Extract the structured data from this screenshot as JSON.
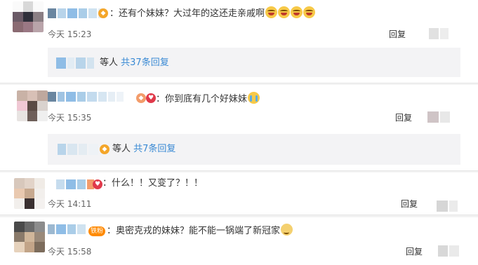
{
  "comments": [
    {
      "text": "：还有个妹妹？大过年的这还走亲戚啊",
      "time": "今天 15:23",
      "reply_label": "回复",
      "emoji_icons": [
        "laughing-tears-icon",
        "laughing-tears-icon",
        "laughing-tears-icon",
        "laughing-tears-icon"
      ],
      "sub_thread": {
        "people_suffix": "等人",
        "count_link": "共37条回复"
      }
    },
    {
      "text": "：你到底有几个好妹妹",
      "time": "今天 15:35",
      "reply_label": "回复",
      "emoji_icons": [
        "crying-icon"
      ],
      "sub_thread": {
        "people_suffix": "等人",
        "count_link": "共7条回复"
      }
    },
    {
      "text": "：什么！！又变了？！！",
      "time": "今天 14:11",
      "reply_label": "回复"
    },
    {
      "badge_label": "铁粉",
      "text": "：奥密克戎的妹妹？能不能一锅端了新冠家",
      "time": "今天 15:58",
      "reply_label": "回复",
      "emoji_icons": [
        "doge-icon"
      ]
    }
  ],
  "colors": {
    "link": "#3a8ad4",
    "vip_badge": "#ff8a00",
    "sub_thread_bg": "#f3f3f5",
    "page_bg": "#f2f2f2"
  }
}
